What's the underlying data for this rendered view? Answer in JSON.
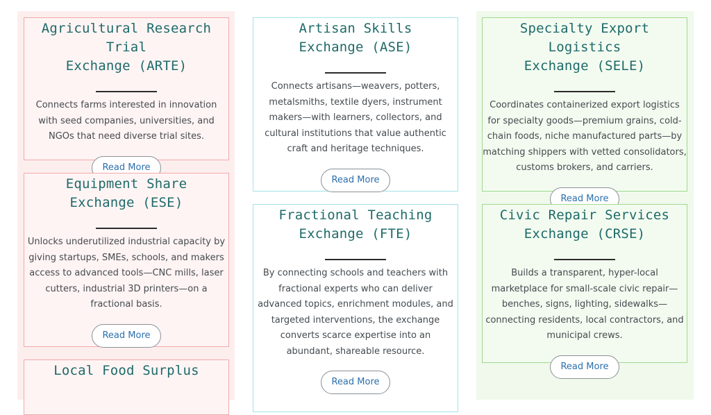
{
  "cards": {
    "arte": {
      "title_line1": "Agricultural Research Trial",
      "title_line2": "Exchange (ARTE)",
      "description": "Connects farms interested in innovation with seed companies, universities, and NGOs that need diverse trial sites.",
      "button": "Read More"
    },
    "ese": {
      "title_line1": "Equipment Share",
      "title_line2": "Exchange (ESE)",
      "description": "Unlocks underutilized industrial capacity by giving startups, SMEs, schools, and makers access to advanced tools—CNC mills, laser cutters, industrial 3D printers—on a fractional basis.",
      "button": "Read More"
    },
    "lfse": {
      "title_line1": "Local Food Surplus"
    },
    "ase": {
      "title_line1": "Artisan Skills",
      "title_line2": "Exchange (ASE)",
      "description": "Connects artisans—weavers, potters, metalsmiths, textile dyers, instrument makers—with learners, collectors, and cultural institutions that value authentic craft and heritage techniques.",
      "button": "Read More"
    },
    "fte": {
      "title_line1": "Fractional Teaching",
      "title_line2": "Exchange (FTE)",
      "description": "By connecting schools and teachers with fractional experts who can deliver advanced topics, enrichment modules, and targeted interventions, the exchange converts scarce expertise into an abundant, shareable resource.",
      "button": "Read More"
    },
    "sele": {
      "title_line1": "Specialty Export Logistics",
      "title_line2": "Exchange (SELE)",
      "description": "Coordinates containerized export logistics for specialty goods—premium grains, cold-chain foods, niche manufactured parts—by matching shippers with vetted consolidators, customs brokers, and carriers.",
      "button": "Read More"
    },
    "crse": {
      "title_line1": "Civic Repair Services",
      "title_line2": "Exchange (CRSE)",
      "description": "Builds a transparent, hyper-local marketplace for small-scale civic repair—benches, signs, lighting, sidewalks—connecting residents, local contractors, and municipal crews.",
      "button": "Read More"
    }
  },
  "colors": {
    "title": "#1e6a69",
    "red_border": "#f1a9a9",
    "teal_border": "#a4e2ec",
    "green_border": "#9fd98e",
    "button_text": "#2b6fab"
  }
}
